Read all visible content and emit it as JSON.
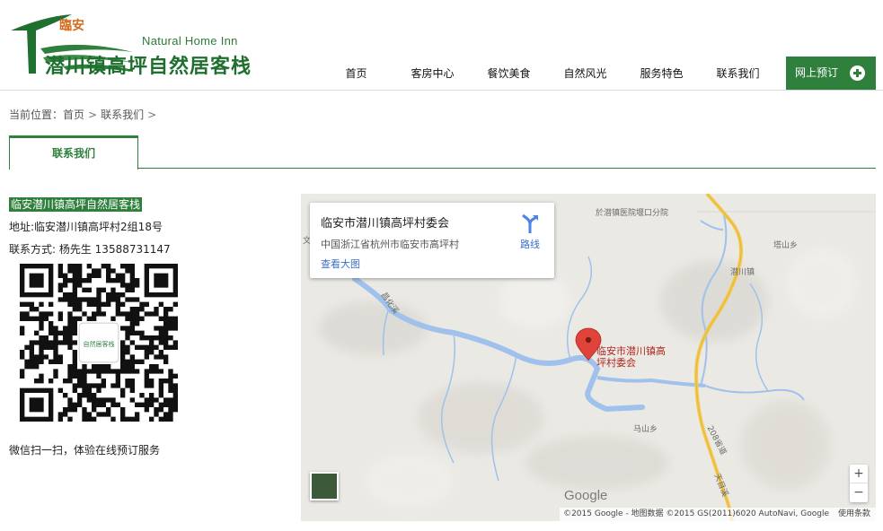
{
  "header": {
    "logo_seal": "臨安",
    "logo_en": "Natural Home Inn",
    "logo_cn": "潜川镇高坪自然居客栈",
    "nav": [
      "首页",
      "客房中心",
      "餐饮美食",
      "自然风光",
      "服务特色",
      "联系我们"
    ],
    "book_label": "网上预订",
    "accent_color": "#2f7f3d"
  },
  "breadcrumb": {
    "prefix": "当前位置：",
    "home": "首页",
    "current": "联系我们",
    "separator": ">"
  },
  "tab": {
    "label": "联系我们"
  },
  "contact": {
    "name": "临安潜川镇高坪自然居客栈",
    "address": "地址:临安潜川镇高坪村2组18号",
    "phone": "联系方式: 杨先生  13588731147",
    "qr_center_text": "自然居客栈",
    "qr_caption": "微信扫一扫，体验在线预订服务"
  },
  "map": {
    "card_title": "临安市潜川镇高坪村委会",
    "card_address": "中国浙江省杭州市临安市高坪村",
    "card_view_link": "查看大图",
    "card_directions": "路线",
    "pin_label": "临安市潜川镇高坪村委会",
    "labels": {
      "hospital": "於潜镇医院堰口分院",
      "road_left": "文",
      "village1": "塔山乡",
      "town": "潜川镇",
      "village2": "马山乡",
      "road": "208省道",
      "river": "天目溪",
      "creek": "昌化溪"
    },
    "zoom_in": "+",
    "zoom_out": "−",
    "google_logo": "Google",
    "attribution": "©2015 Google - 地图数据 ©2015 GS(2011)6020 AutoNavi, Google",
    "terms": "使用条款",
    "water_color": "#9fc1ec",
    "road_color": "#f2c94c",
    "pin_color": "#e0433a"
  }
}
